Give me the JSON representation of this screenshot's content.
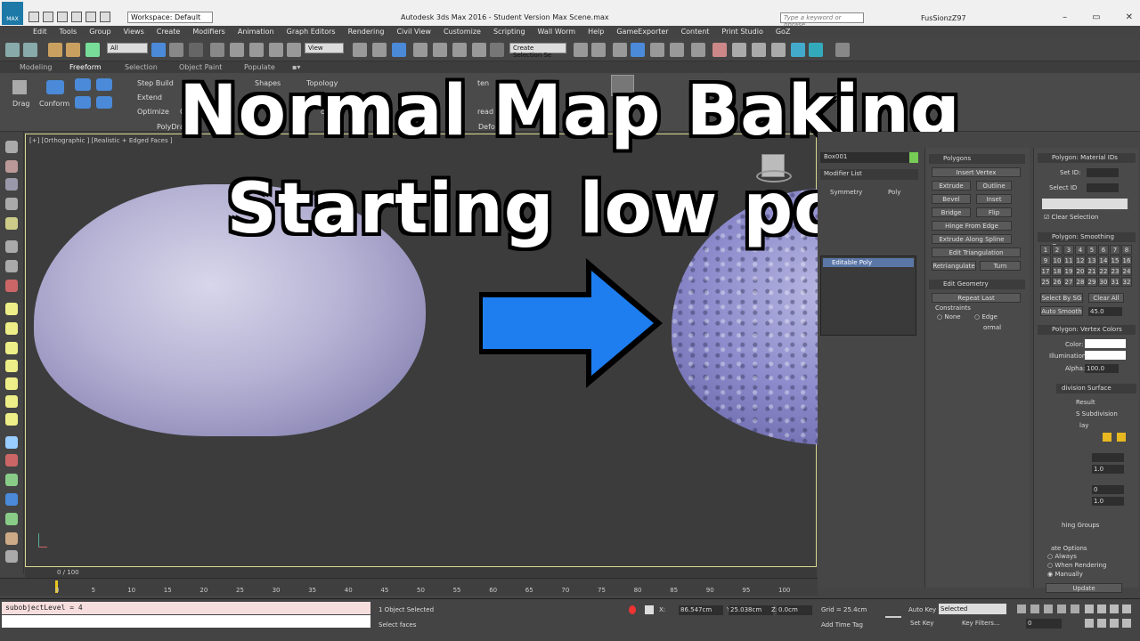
{
  "window": {
    "app_title": "Autodesk 3ds Max 2016 - Student Version    Max Scene.max",
    "workspace": "Workspace: Default",
    "search_placeholder": "Type a keyword or phrase",
    "user": "FusSionzZ97",
    "logo": "MAX",
    "controls": [
      "–",
      "▭",
      "✕"
    ]
  },
  "menu": [
    "Edit",
    "Tools",
    "Group",
    "Views",
    "Create",
    "Modifiers",
    "Animation",
    "Graph Editors",
    "Rendering",
    "Civil View",
    "Customize",
    "Scripting",
    "Wall Worm",
    "Help",
    "GameExporter",
    "Content",
    "Print Studio",
    "GoZ"
  ],
  "toolbar": {
    "selection_filter": "All",
    "ref_coord": "View",
    "named_selection": "Create Selection Se"
  },
  "ribbon_tabs": [
    "Modeling",
    "Freeform",
    "Selection",
    "Object Paint",
    "Populate"
  ],
  "ribbon": {
    "drag": "Drag",
    "conform": "Conform",
    "step_build": "Step Build",
    "extend": "Extend",
    "optimize": "Optimize",
    "shapes": "Shapes",
    "topology": "Topology",
    "polydraw": "PolyDraw",
    "deform": "Deform",
    "read": "read",
    "re": "Re",
    "ten": "ten",
    "of": "Of",
    "cne": "cne"
  },
  "overlay": {
    "line1": "Normal Map Baking",
    "line2": "Starting low poly"
  },
  "viewport": {
    "label": "[+] [Orthographic ] [Realistic + Edged Faces ]"
  },
  "command_panel": {
    "object_name": "Box001",
    "modifier_list": "Modifier List",
    "symmetry": "Symmetry",
    "poly_tab": "Poly",
    "stack_item": "Editable Poly",
    "edit_polygons": {
      "title": "Polygons",
      "insert_vertex": "Insert Vertex",
      "extrude": "Extrude",
      "outline": "Outline",
      "bevel": "Bevel",
      "inset": "Inset",
      "bridge": "Bridge",
      "flip": "Flip",
      "hinge": "Hinge From Edge",
      "extrude_spline": "Extrude Along Spline",
      "edit_triangulation": "Edit Triangulation",
      "retriangulate": "Retriangulate",
      "turn": "Turn"
    },
    "edit_geometry": {
      "title": "Edit Geometry",
      "repeat_last": "Repeat Last",
      "constraints": "Constraints",
      "none": "None",
      "edge": "Edge",
      "normal": "ormal"
    },
    "material_ids": {
      "title": "Polygon: Material IDs",
      "set_id": "Set ID:",
      "select_id": "Select ID",
      "clear_selection": "Clear Selection"
    },
    "smoothing": {
      "title": "Polygon: Smoothing Groups",
      "groups": [
        "1",
        "2",
        "3",
        "4",
        "5",
        "6",
        "7",
        "8",
        "9",
        "10",
        "11",
        "12",
        "13",
        "14",
        "15",
        "16",
        "17",
        "18",
        "19",
        "20",
        "21",
        "22",
        "23",
        "24",
        "25",
        "26",
        "27",
        "28",
        "29",
        "30",
        "31",
        "32"
      ],
      "select_by_sg": "Select By SG",
      "clear_all": "Clear All",
      "auto_smooth": "Auto Smooth",
      "auto_smooth_value": "45.0"
    },
    "vertex_colors": {
      "title": "Polygon: Vertex Colors",
      "color": "Color:",
      "illumination": "Illumination:",
      "alpha": "Alpha:",
      "alpha_value": "100.0"
    },
    "subdivision": {
      "title": "division Surface",
      "result": "Result",
      "subdivision": "S Subdivision",
      "lay": "lay",
      "val1": "1.0",
      "val2": "0",
      "val3": "1.0",
      "smoothing_groups": "hing Groups",
      "update_options": "ate Options",
      "always": "Always",
      "when_rendering": "When Rendering",
      "manually": "Manually",
      "update": "Update"
    }
  },
  "timeline": {
    "label": "0 / 100",
    "ticks": [
      "0",
      "5",
      "10",
      "15",
      "20",
      "25",
      "30",
      "35",
      "40",
      "45",
      "50",
      "55",
      "60",
      "65",
      "70",
      "75",
      "80",
      "85",
      "90",
      "95",
      "100"
    ]
  },
  "status": {
    "maxscript": "subobjectLevel = 4",
    "objects": "1 Object Selected",
    "prompt": "Select faces",
    "x_label": "X:",
    "x": "86.547cm",
    "y_label": "Y:",
    "y": "25.038cm",
    "z_label": "Z:",
    "z": "0.0cm",
    "grid": "Grid = 25.4cm",
    "add_time_tag": "Add Time Tag",
    "auto_key": "Auto Key",
    "set_key": "Set Key",
    "selected": "Selected",
    "key_filters": "Key Filters...",
    "frame": "0"
  }
}
